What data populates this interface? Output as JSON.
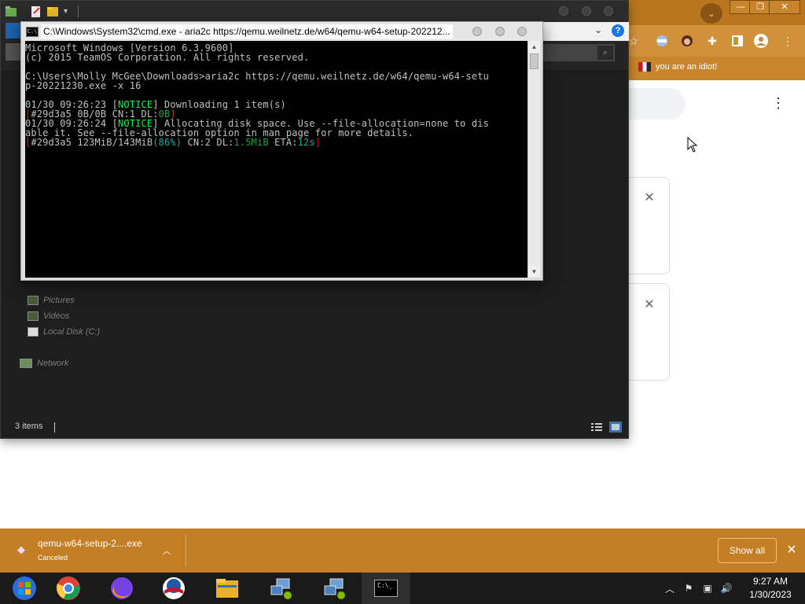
{
  "chrome": {
    "bookmark_label": "you are an idiot!",
    "window_controls": [
      "—",
      "❐",
      "✕"
    ],
    "kebab": "⋮",
    "card_close": "✕"
  },
  "explorer": {
    "sidebar": [
      {
        "label": "Pictures"
      },
      {
        "label": "Videos"
      },
      {
        "label": "Local Disk (C:)"
      },
      {
        "label": "Network"
      }
    ],
    "status": "3 items"
  },
  "cmd": {
    "title": "C:\\Windows\\System32\\cmd.exe - aria2c  https://qemu.weilnetz.de/w64/qemu-w64-setup-202212...",
    "lines": {
      "l1": "Microsoft Windows [Version 6.3.9600]",
      "l2": "(c) 2015 TeamOS Corporation. All rights reserved.",
      "l3": "C:\\Users\\Molly McGee\\Downloads>aria2c https://qemu.weilnetz.de/w64/qemu-w64-setu",
      "l4": "p-20221230.exe -x 16",
      "l5_pre": "01/30 09:26:23 [",
      "l5_tag": "NOTICE",
      "l5_post": "] Downloading 1 item(s)",
      "l6_a": "[",
      "l6_b": "#29d3a5 0B/0B CN:1 DL:",
      "l6_c": "0B",
      "l6_d": "]",
      "l7_pre": "01/30 09:26:24 [",
      "l7_tag": "NOTICE",
      "l7_post": "] Allocating disk space. Use --file-allocation=none to dis",
      "l8": "able it. See --file-allocation option in man page for more details.",
      "l9_a": "[",
      "l9_b": "#29d3a5 123MiB/143MiB",
      "l9_c": "(86%)",
      "l9_d": " CN:2 DL:",
      "l9_e": "1.5MiB",
      "l9_f": " ETA:",
      "l9_g": "12s",
      "l9_h": "]"
    },
    "scroll_up": "▲",
    "scroll_down": "▼"
  },
  "download": {
    "filename": "qemu-w64-setup-2....exe",
    "status": "Canceled",
    "show_all": "Show all",
    "close": "✕",
    "chevron": "︿"
  },
  "taskbar": {
    "cmd_icon_text": "C:\\_",
    "time": "9:27 AM",
    "date": "1/30/2023",
    "tray": [
      "︿",
      "⚑",
      "▣",
      "🔊"
    ]
  }
}
